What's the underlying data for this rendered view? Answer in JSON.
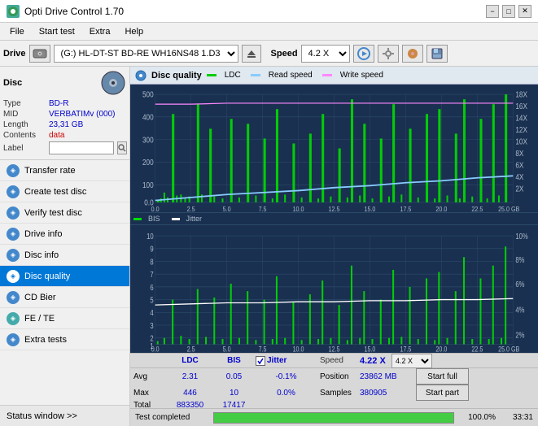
{
  "app": {
    "title": "Opti Drive Control 1.70",
    "icon": "ODC"
  },
  "title_bar": {
    "minimize": "−",
    "maximize": "□",
    "close": "✕"
  },
  "menu": {
    "items": [
      "File",
      "Start test",
      "Extra",
      "Help"
    ]
  },
  "drive_bar": {
    "label": "Drive",
    "drive_value": "(G:) HL-DT-ST BD-RE  WH16NS48 1.D3",
    "speed_label": "Speed",
    "speed_value": "4.2 X"
  },
  "disc": {
    "header": "Disc",
    "type_label": "Type",
    "type_value": "BD-R",
    "mid_label": "MID",
    "mid_value": "VERBATIMv (000)",
    "length_label": "Length",
    "length_value": "23,31 GB",
    "contents_label": "Contents",
    "contents_value": "data",
    "label_label": "Label",
    "label_value": ""
  },
  "nav": {
    "items": [
      {
        "id": "transfer-rate",
        "label": "Transfer rate",
        "active": false
      },
      {
        "id": "create-test-disc",
        "label": "Create test disc",
        "active": false
      },
      {
        "id": "verify-test-disc",
        "label": "Verify test disc",
        "active": false
      },
      {
        "id": "drive-info",
        "label": "Drive info",
        "active": false
      },
      {
        "id": "disc-info",
        "label": "Disc info",
        "active": false
      },
      {
        "id": "disc-quality",
        "label": "Disc quality",
        "active": true
      },
      {
        "id": "cd-bier",
        "label": "CD Bier",
        "active": false
      },
      {
        "id": "fe-te",
        "label": "FE / TE",
        "active": false
      },
      {
        "id": "extra-tests",
        "label": "Extra tests",
        "active": false
      }
    ]
  },
  "status_window": {
    "label": "Status window >> "
  },
  "disc_quality": {
    "title": "Disc quality",
    "legend": {
      "ldc_label": "LDC",
      "read_label": "Read speed",
      "write_label": "Write speed",
      "bis_label": "BIS",
      "jitter_label": "Jitter"
    }
  },
  "stats": {
    "headers": {
      "ldc": "LDC",
      "bis": "BIS",
      "jitter": "Jitter",
      "speed": "Speed",
      "speed_value": "4.22 X"
    },
    "rows": {
      "avg": {
        "label": "Avg",
        "ldc": "2.31",
        "bis": "0.05",
        "jitter": "-0.1%",
        "position_label": "Position",
        "position_value": "23862 MB"
      },
      "max": {
        "label": "Max",
        "ldc": "446",
        "bis": "10",
        "jitter": "0.0%",
        "samples_label": "Samples",
        "samples_value": "380905"
      },
      "total": {
        "label": "Total",
        "ldc": "883350",
        "bis": "17417",
        "jitter": ""
      }
    },
    "buttons": {
      "start_full": "Start full",
      "start_part": "Start part"
    },
    "jitter_checked": true,
    "speed_dropdown": "4.2 X"
  },
  "progress": {
    "text": "Test completed",
    "percent": "100.0%",
    "time": "33:31",
    "fill_percent": 100
  },
  "chart_top": {
    "y_left_max": 500,
    "y_right_labels": [
      "18X",
      "16X",
      "14X",
      "12X",
      "10X",
      "8X",
      "6X",
      "4X",
      "2X"
    ],
    "x_labels": [
      "0.0",
      "2.5",
      "5.0",
      "7.5",
      "10.0",
      "12.5",
      "15.0",
      "17.5",
      "20.0",
      "22.5",
      "25.0 GB"
    ],
    "y_left_labels": [
      "500",
      "400",
      "300",
      "200",
      "100",
      "0.0"
    ]
  },
  "chart_bottom": {
    "y_left_max": 10,
    "y_right_labels": [
      "10%",
      "8%",
      "6%",
      "4%",
      "2%"
    ],
    "x_labels": [
      "0.0",
      "2.5",
      "5.0",
      "7.5",
      "10.0",
      "12.5",
      "15.0",
      "17.5",
      "20.0",
      "22.5",
      "25.0 GB"
    ],
    "y_left_labels": [
      "10",
      "9",
      "8",
      "7",
      "6",
      "5",
      "4",
      "3",
      "2",
      "1"
    ]
  }
}
